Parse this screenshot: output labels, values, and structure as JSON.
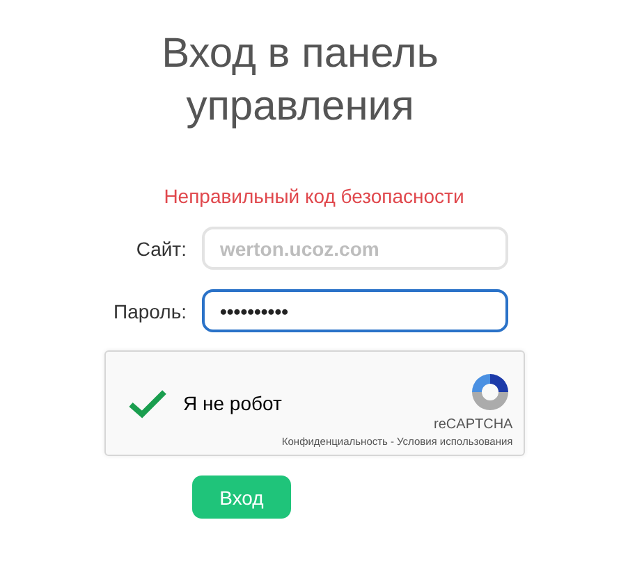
{
  "title": "Вход в панель управления",
  "error": "Неправильный код безопасности",
  "fields": [
    {
      "label": "Сайт:",
      "placeholder": "werton.ucoz.com",
      "focused": false
    },
    {
      "label": "Пароль:",
      "value": "••••••••••",
      "focused": true
    }
  ],
  "captcha": {
    "label": "Я не робот",
    "checked": true,
    "brand": "reCAPTCHA",
    "links": [
      "Конфиденциальность",
      "Условия использования"
    ],
    "separator": "-"
  },
  "submit": "Вход"
}
